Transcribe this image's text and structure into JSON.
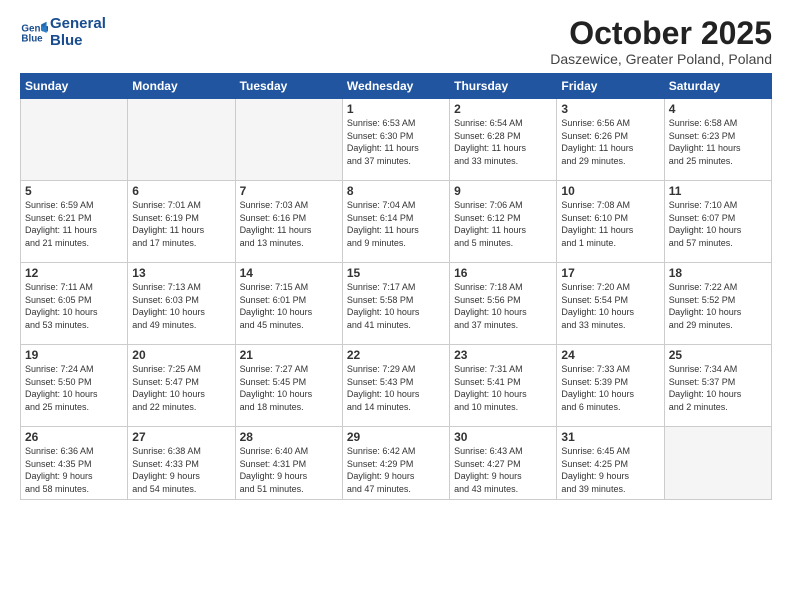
{
  "header": {
    "logo_line1": "General",
    "logo_line2": "Blue",
    "month": "October 2025",
    "location": "Daszewice, Greater Poland, Poland"
  },
  "weekdays": [
    "Sunday",
    "Monday",
    "Tuesday",
    "Wednesday",
    "Thursday",
    "Friday",
    "Saturday"
  ],
  "weeks": [
    [
      {
        "day": "",
        "info": ""
      },
      {
        "day": "",
        "info": ""
      },
      {
        "day": "",
        "info": ""
      },
      {
        "day": "1",
        "info": "Sunrise: 6:53 AM\nSunset: 6:30 PM\nDaylight: 11 hours\nand 37 minutes."
      },
      {
        "day": "2",
        "info": "Sunrise: 6:54 AM\nSunset: 6:28 PM\nDaylight: 11 hours\nand 33 minutes."
      },
      {
        "day": "3",
        "info": "Sunrise: 6:56 AM\nSunset: 6:26 PM\nDaylight: 11 hours\nand 29 minutes."
      },
      {
        "day": "4",
        "info": "Sunrise: 6:58 AM\nSunset: 6:23 PM\nDaylight: 11 hours\nand 25 minutes."
      }
    ],
    [
      {
        "day": "5",
        "info": "Sunrise: 6:59 AM\nSunset: 6:21 PM\nDaylight: 11 hours\nand 21 minutes."
      },
      {
        "day": "6",
        "info": "Sunrise: 7:01 AM\nSunset: 6:19 PM\nDaylight: 11 hours\nand 17 minutes."
      },
      {
        "day": "7",
        "info": "Sunrise: 7:03 AM\nSunset: 6:16 PM\nDaylight: 11 hours\nand 13 minutes."
      },
      {
        "day": "8",
        "info": "Sunrise: 7:04 AM\nSunset: 6:14 PM\nDaylight: 11 hours\nand 9 minutes."
      },
      {
        "day": "9",
        "info": "Sunrise: 7:06 AM\nSunset: 6:12 PM\nDaylight: 11 hours\nand 5 minutes."
      },
      {
        "day": "10",
        "info": "Sunrise: 7:08 AM\nSunset: 6:10 PM\nDaylight: 11 hours\nand 1 minute."
      },
      {
        "day": "11",
        "info": "Sunrise: 7:10 AM\nSunset: 6:07 PM\nDaylight: 10 hours\nand 57 minutes."
      }
    ],
    [
      {
        "day": "12",
        "info": "Sunrise: 7:11 AM\nSunset: 6:05 PM\nDaylight: 10 hours\nand 53 minutes."
      },
      {
        "day": "13",
        "info": "Sunrise: 7:13 AM\nSunset: 6:03 PM\nDaylight: 10 hours\nand 49 minutes."
      },
      {
        "day": "14",
        "info": "Sunrise: 7:15 AM\nSunset: 6:01 PM\nDaylight: 10 hours\nand 45 minutes."
      },
      {
        "day": "15",
        "info": "Sunrise: 7:17 AM\nSunset: 5:58 PM\nDaylight: 10 hours\nand 41 minutes."
      },
      {
        "day": "16",
        "info": "Sunrise: 7:18 AM\nSunset: 5:56 PM\nDaylight: 10 hours\nand 37 minutes."
      },
      {
        "day": "17",
        "info": "Sunrise: 7:20 AM\nSunset: 5:54 PM\nDaylight: 10 hours\nand 33 minutes."
      },
      {
        "day": "18",
        "info": "Sunrise: 7:22 AM\nSunset: 5:52 PM\nDaylight: 10 hours\nand 29 minutes."
      }
    ],
    [
      {
        "day": "19",
        "info": "Sunrise: 7:24 AM\nSunset: 5:50 PM\nDaylight: 10 hours\nand 25 minutes."
      },
      {
        "day": "20",
        "info": "Sunrise: 7:25 AM\nSunset: 5:47 PM\nDaylight: 10 hours\nand 22 minutes."
      },
      {
        "day": "21",
        "info": "Sunrise: 7:27 AM\nSunset: 5:45 PM\nDaylight: 10 hours\nand 18 minutes."
      },
      {
        "day": "22",
        "info": "Sunrise: 7:29 AM\nSunset: 5:43 PM\nDaylight: 10 hours\nand 14 minutes."
      },
      {
        "day": "23",
        "info": "Sunrise: 7:31 AM\nSunset: 5:41 PM\nDaylight: 10 hours\nand 10 minutes."
      },
      {
        "day": "24",
        "info": "Sunrise: 7:33 AM\nSunset: 5:39 PM\nDaylight: 10 hours\nand 6 minutes."
      },
      {
        "day": "25",
        "info": "Sunrise: 7:34 AM\nSunset: 5:37 PM\nDaylight: 10 hours\nand 2 minutes."
      }
    ],
    [
      {
        "day": "26",
        "info": "Sunrise: 6:36 AM\nSunset: 4:35 PM\nDaylight: 9 hours\nand 58 minutes."
      },
      {
        "day": "27",
        "info": "Sunrise: 6:38 AM\nSunset: 4:33 PM\nDaylight: 9 hours\nand 54 minutes."
      },
      {
        "day": "28",
        "info": "Sunrise: 6:40 AM\nSunset: 4:31 PM\nDaylight: 9 hours\nand 51 minutes."
      },
      {
        "day": "29",
        "info": "Sunrise: 6:42 AM\nSunset: 4:29 PM\nDaylight: 9 hours\nand 47 minutes."
      },
      {
        "day": "30",
        "info": "Sunrise: 6:43 AM\nSunset: 4:27 PM\nDaylight: 9 hours\nand 43 minutes."
      },
      {
        "day": "31",
        "info": "Sunrise: 6:45 AM\nSunset: 4:25 PM\nDaylight: 9 hours\nand 39 minutes."
      },
      {
        "day": "",
        "info": ""
      }
    ]
  ]
}
